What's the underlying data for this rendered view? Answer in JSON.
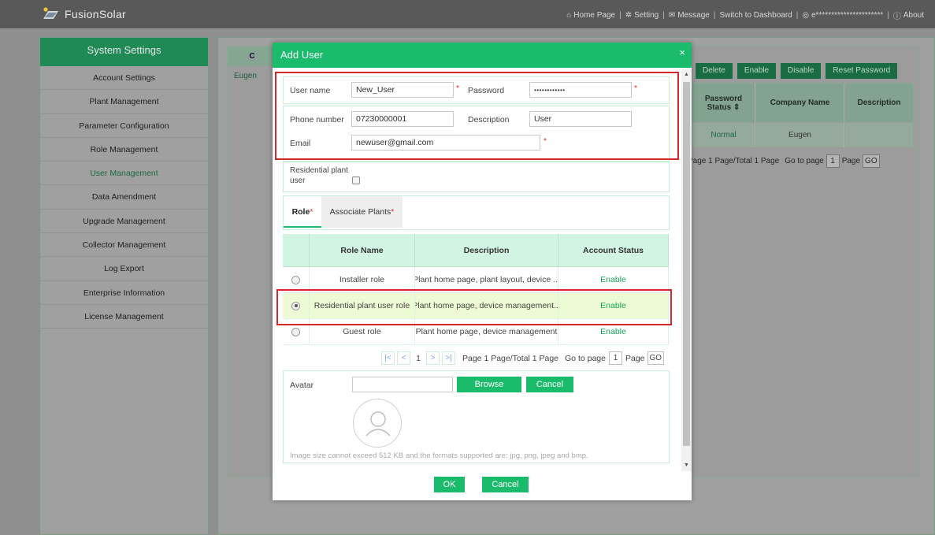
{
  "app": {
    "brand": "FusionSolar"
  },
  "topnav": {
    "home": "Home Page",
    "setting": "Setting",
    "message": "Message",
    "switch": "Switch to Dashboard",
    "account": "e**********************",
    "about": "About",
    "separator": "|"
  },
  "sidebar": {
    "title": "System Settings",
    "items": [
      {
        "label": "Account Settings"
      },
      {
        "label": "Plant Management"
      },
      {
        "label": "Parameter Configuration"
      },
      {
        "label": "Role Management"
      },
      {
        "label": "User Management"
      },
      {
        "label": "Data Amendment"
      },
      {
        "label": "Upgrade Management"
      },
      {
        "label": "Collector Management"
      },
      {
        "label": "Log Export"
      },
      {
        "label": "Enterprise Information"
      },
      {
        "label": "License Management"
      }
    ],
    "active_index": 4
  },
  "background": {
    "left_header": "C",
    "left_cell": "Eugen",
    "buttons": {
      "delete": "Delete",
      "enable": "Enable",
      "disable": "Disable",
      "reset": "Reset Password"
    },
    "columns": {
      "password_status": "Password Status ⇕",
      "company": "Company Name",
      "description": "Description"
    },
    "row": {
      "password_status": "Normal",
      "company": "Eugen",
      "description": ""
    },
    "pager": {
      "text": "Page 1 Page/Total 1 Page",
      "goto": "Go to page",
      "page_value": "1",
      "page_word": "Page",
      "go": "GO"
    }
  },
  "modal": {
    "title": "Add User",
    "close": "×",
    "form": {
      "username_label": "User name",
      "username_value": "New_User",
      "password_label": "Password",
      "password_value": "••••••••••••",
      "phone_label": "Phone number",
      "phone_value": "07230000001",
      "description_label": "Description",
      "description_value": "User",
      "email_label": "Email",
      "email_value": "newuser@gmail.com",
      "residential_label": "Residential plant user",
      "required_mark": "*"
    },
    "tabs": {
      "role": "Role",
      "associate": "Associate Plants",
      "required_mark": "*"
    },
    "role_table": {
      "headers": {
        "name": "Role Name",
        "description": "Description",
        "status": "Account Status"
      },
      "rows": [
        {
          "name": "Installer role",
          "description": "Plant home page, plant layout, device ...",
          "status": "Enable",
          "selected": false
        },
        {
          "name": "Residential plant user role",
          "description": "Plant home page, device management...",
          "status": "Enable",
          "selected": true
        },
        {
          "name": "Guest role",
          "description": "Plant home page, device management",
          "status": "Enable",
          "selected": false
        }
      ],
      "pager": {
        "page": "1",
        "text": "Page 1 Page/Total 1 Page",
        "goto": "Go to page",
        "page_value": "1",
        "page_word": "Page",
        "go": "GO"
      }
    },
    "avatar": {
      "label": "Avatar",
      "value": "",
      "browse": "Browse",
      "cancel": "Cancel",
      "hint": "Image size cannot exceed 512 KB and the formats supported are: jpg, png, jpeg and bmp."
    },
    "footer": {
      "ok": "OK",
      "cancel": "Cancel"
    }
  },
  "colors": {
    "accent": "#1abc6c",
    "highlight": "#d5262b",
    "status_enable": "#18a35b"
  }
}
